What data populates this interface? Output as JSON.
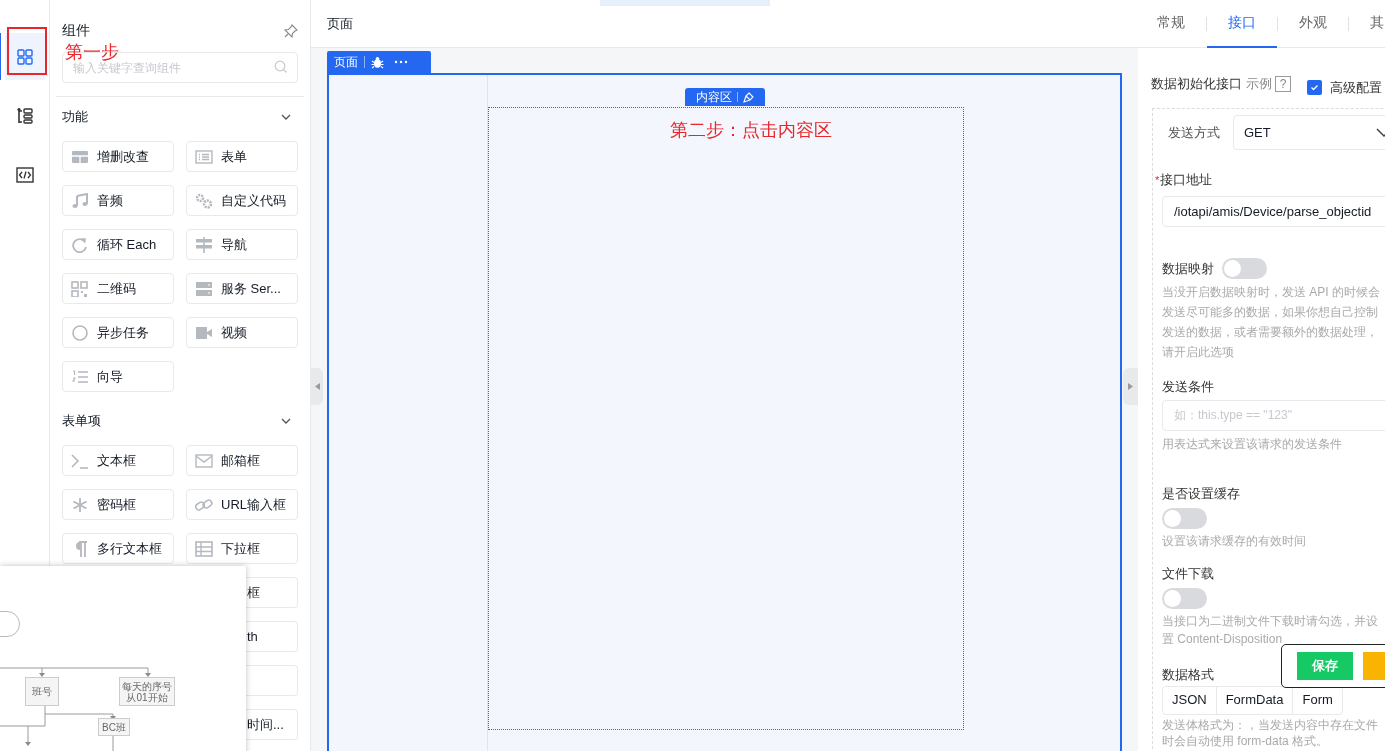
{
  "sidebar": {
    "items": [
      {
        "selected": true
      },
      {
        "selected": false
      },
      {
        "selected": false
      }
    ],
    "step_note": "第一步"
  },
  "component_panel": {
    "title": "组件",
    "search": {
      "placeholder": "输入关键字查询组件"
    },
    "groups": [
      {
        "title": "功能",
        "expanded": true,
        "items": [
          {
            "label": "增删改查"
          },
          {
            "label": "表单"
          },
          {
            "label": "音频"
          },
          {
            "label": "自定义代码"
          },
          {
            "label": "循环 Each"
          },
          {
            "label": "导航"
          },
          {
            "label": "二维码"
          },
          {
            "label": "服务 Ser..."
          },
          {
            "label": "异步任务"
          },
          {
            "label": "视频"
          },
          {
            "label": "向导"
          }
        ]
      },
      {
        "title": "表单项",
        "expanded": true,
        "items": [
          {
            "label": "文本框"
          },
          {
            "label": "邮箱框"
          },
          {
            "label": "密码框"
          },
          {
            "label": "URL输入框"
          },
          {
            "label": "多行文本框"
          },
          {
            "label": "下拉框"
          },
          {
            "kind": "partial",
            "label": "框"
          },
          {
            "kind": "partial",
            "label": "th"
          },
          {
            "kind": "partial"
          },
          {
            "kind": "partial",
            "label": "时间..."
          }
        ]
      }
    ]
  },
  "flowchart_overlay": {
    "nodes": [
      {
        "lines": [
          "班号"
        ]
      },
      {
        "lines": [
          "每天的序号",
          "从01开始"
        ]
      },
      {
        "lines": [
          "BC班"
        ]
      }
    ]
  },
  "canvas": {
    "title": "页面",
    "page_tab": {
      "label": "页面"
    },
    "content_tab": {
      "label": "内容区"
    },
    "step_note": "第二步：点击内容区"
  },
  "properties": {
    "tabs": [
      {
        "label": "常规",
        "selected": false
      },
      {
        "label": "接口",
        "selected": true
      },
      {
        "label": "外观",
        "selected": false
      },
      {
        "label": "其",
        "selected": false
      }
    ],
    "api_label": "数据初始化接口",
    "example": "示例",
    "help": "?",
    "advanced": {
      "label": "高级配置",
      "checked": true
    },
    "method": {
      "label": "发送方式",
      "value": "GET"
    },
    "url": {
      "required_mark": "*",
      "label": "接口地址",
      "value": "/iotapi/amis/Device/parse_objectid"
    },
    "fields": [
      {
        "kind": "switch-inline",
        "label": "数据映射",
        "on": false,
        "description": "当没开启数据映射时，发送 API 的时候会发送尽可能多的数据，如果你想自己控制发送的数据，或者需要额外的数据处理，请开启此选项"
      },
      {
        "kind": "input",
        "label": "发送条件",
        "placeholder": "如：this.type == \"123\"",
        "description": "用表达式来设置该请求的发送条件"
      },
      {
        "kind": "switch",
        "label": "是否设置缓存",
        "on": false,
        "description": "设置该请求缓存的有效时间"
      },
      {
        "kind": "switch",
        "label": "文件下载",
        "on": false,
        "description": "当接口为二进制文件下载时请勾选，并设置 Content-Disposition"
      },
      {
        "kind": "segmented",
        "label": "数据格式",
        "options": [
          "JSON",
          "FormData",
          "Form"
        ],
        "description": "发送体格式为：，当发送内容中存在文件时会自动使用 form-data 格式。"
      }
    ]
  },
  "actions": [
    {
      "kind": "save",
      "label": "保存"
    },
    {
      "kind": "preview"
    }
  ]
}
